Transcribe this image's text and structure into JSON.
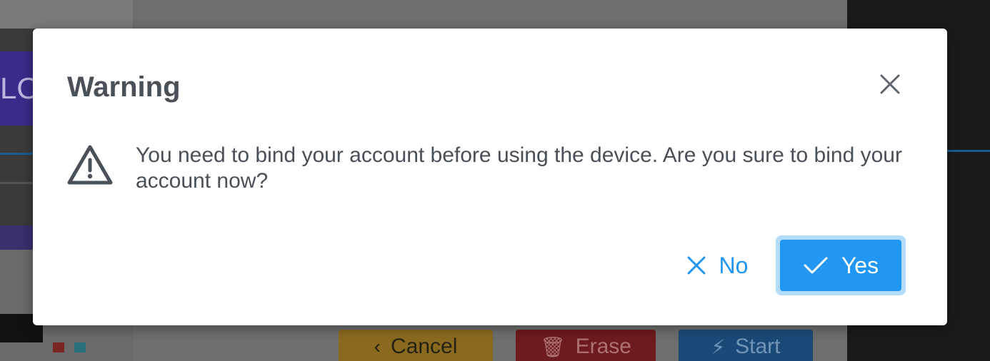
{
  "dialog": {
    "title": "Warning",
    "message": "You need to bind your account before using the device. Are you sure to bind your account now?",
    "no_label": "No",
    "yes_label": "Yes",
    "close_icon": "close-icon",
    "warning_icon": "warning-triangle-icon",
    "accent_color": "#2196f3"
  },
  "background": {
    "logo_text": "LO",
    "buttons": {
      "cancel_label": "Cancel",
      "erase_label": "Erase",
      "start_label": "Start"
    }
  }
}
